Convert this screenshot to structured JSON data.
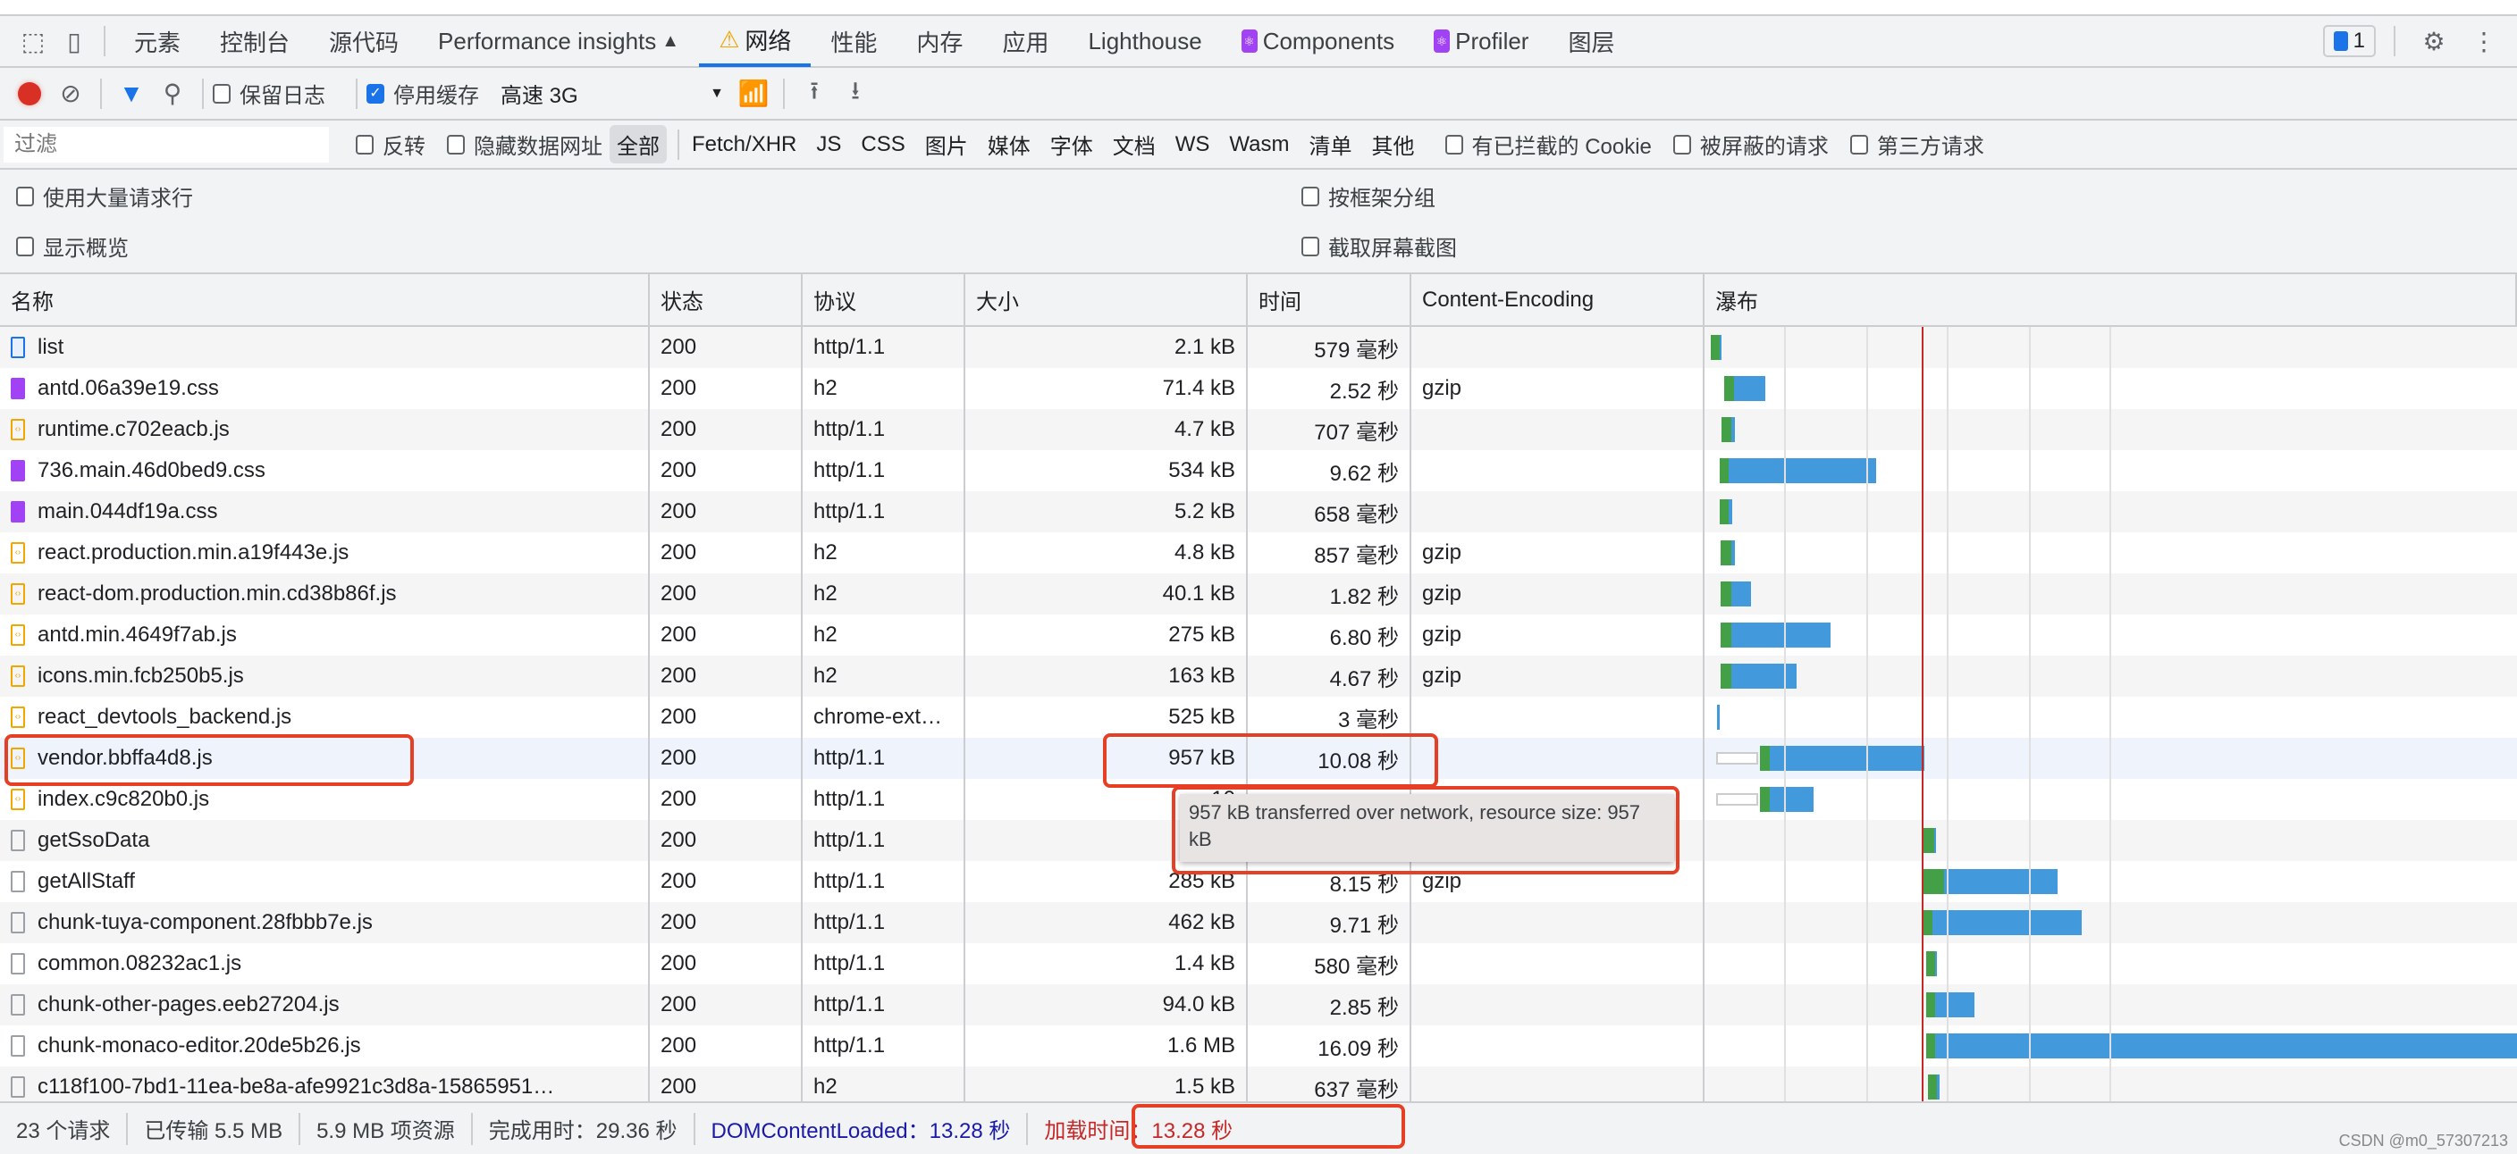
{
  "tabs": [
    {
      "label": "元素"
    },
    {
      "label": "控制台"
    },
    {
      "label": "源代码"
    },
    {
      "label": "Performance insights",
      "icon": "flask-icon"
    },
    {
      "label": "网络",
      "icon": "warning-icon",
      "active": true
    },
    {
      "label": "性能"
    },
    {
      "label": "内存"
    },
    {
      "label": "应用"
    },
    {
      "label": "Lighthouse"
    },
    {
      "label": "Components",
      "icon": "react-icon"
    },
    {
      "label": "Profiler",
      "icon": "react-icon"
    },
    {
      "label": "图层"
    }
  ],
  "issues_count": "1",
  "toolbar": {
    "preserve_log": "保留日志",
    "disable_cache": "停用缓存",
    "throttle": "高速 3G"
  },
  "filter": {
    "placeholder": "过滤",
    "invert": "反转",
    "hide_data_urls": "隐藏数据网址",
    "types": [
      "全部",
      "Fetch/XHR",
      "JS",
      "CSS",
      "图片",
      "媒体",
      "字体",
      "文档",
      "WS",
      "Wasm",
      "清单",
      "其他"
    ],
    "blocked_cookies": "有已拦截的 Cookie",
    "blocked_requests": "被屏蔽的请求",
    "third_party": "第三方请求"
  },
  "options": {
    "big_rows": "使用大量请求行",
    "overview": "显示概览",
    "group_by_frame": "按框架分组",
    "screenshots": "截取屏幕截图"
  },
  "columns": [
    "名称",
    "状态",
    "协议",
    "大小",
    "时间",
    "Content-Encoding",
    "瀑布"
  ],
  "rows": [
    {
      "name": "list",
      "type": "doc",
      "status": "200",
      "protocol": "http/1.1",
      "size": "2.1 kB",
      "time": "579 毫秒",
      "enc": ""
    },
    {
      "name": "antd.06a39e19.css",
      "type": "css",
      "status": "200",
      "protocol": "h2",
      "size": "71.4 kB",
      "time": "2.52 秒",
      "enc": "gzip"
    },
    {
      "name": "runtime.c702eacb.js",
      "type": "js",
      "status": "200",
      "protocol": "http/1.1",
      "size": "4.7 kB",
      "time": "707 毫秒",
      "enc": ""
    },
    {
      "name": "736.main.46d0bed9.css",
      "type": "css",
      "status": "200",
      "protocol": "http/1.1",
      "size": "534 kB",
      "time": "9.62 秒",
      "enc": ""
    },
    {
      "name": "main.044df19a.css",
      "type": "css",
      "status": "200",
      "protocol": "http/1.1",
      "size": "5.2 kB",
      "time": "658 毫秒",
      "enc": ""
    },
    {
      "name": "react.production.min.a19f443e.js",
      "type": "js",
      "status": "200",
      "protocol": "h2",
      "size": "4.8 kB",
      "time": "857 毫秒",
      "enc": "gzip"
    },
    {
      "name": "react-dom.production.min.cd38b86f.js",
      "type": "js",
      "status": "200",
      "protocol": "h2",
      "size": "40.1 kB",
      "time": "1.82 秒",
      "enc": "gzip"
    },
    {
      "name": "antd.min.4649f7ab.js",
      "type": "js",
      "status": "200",
      "protocol": "h2",
      "size": "275 kB",
      "time": "6.80 秒",
      "enc": "gzip"
    },
    {
      "name": "icons.min.fcb250b5.js",
      "type": "js",
      "status": "200",
      "protocol": "h2",
      "size": "163 kB",
      "time": "4.67 秒",
      "enc": "gzip"
    },
    {
      "name": "react_devtools_backend.js",
      "type": "js",
      "status": "200",
      "protocol": "chrome-ext…",
      "size": "525 kB",
      "time": "3 毫秒",
      "enc": ""
    },
    {
      "name": "vendor.bbffa4d8.js",
      "type": "js",
      "status": "200",
      "protocol": "http/1.1",
      "size": "957 kB",
      "time": "10.08 秒",
      "enc": "",
      "selected": true
    },
    {
      "name": "index.c9c820b0.js",
      "type": "js",
      "status": "200",
      "protocol": "http/1.1",
      "size": "10",
      "time": "",
      "enc": ""
    },
    {
      "name": "getSsoData",
      "type": "other",
      "status": "200",
      "protocol": "http/1.1",
      "size": "",
      "time": "",
      "enc": ""
    },
    {
      "name": "getAllStaff",
      "type": "other",
      "status": "200",
      "protocol": "http/1.1",
      "size": "285 kB",
      "time": "8.15 秒",
      "enc": "gzip"
    },
    {
      "name": "chunk-tuya-component.28fbbb7e.js",
      "type": "other",
      "status": "200",
      "protocol": "http/1.1",
      "size": "462 kB",
      "time": "9.71 秒",
      "enc": ""
    },
    {
      "name": "common.08232ac1.js",
      "type": "other",
      "status": "200",
      "protocol": "http/1.1",
      "size": "1.4 kB",
      "time": "580 毫秒",
      "enc": ""
    },
    {
      "name": "chunk-other-pages.eeb27204.js",
      "type": "other",
      "status": "200",
      "protocol": "http/1.1",
      "size": "94.0 kB",
      "time": "2.85 秒",
      "enc": ""
    },
    {
      "name": "chunk-monaco-editor.20de5b26.js",
      "type": "other",
      "status": "200",
      "protocol": "http/1.1",
      "size": "1.6 MB",
      "time": "16.09 秒",
      "enc": ""
    },
    {
      "name": "c118f100-7bd1-11ea-be8a-afe9921c3d8a-15865951…",
      "type": "other",
      "status": "200",
      "protocol": "h2",
      "size": "1.5 kB",
      "time": "637 毫秒",
      "enc": ""
    }
  ],
  "tooltip": "957 kB transferred over network, resource size: 957 kB",
  "status": {
    "requests": "23 个请求",
    "transferred": "已传输 5.5 MB",
    "resources": "5.9 MB 项资源",
    "finish": "完成用时：29.36 秒",
    "dcl": "DOMContentLoaded：13.28 秒",
    "load": "加载时间：13.28 秒"
  },
  "colors": {
    "accent": "#1a73e8",
    "waiting": "#43a047",
    "download": "#4299dc",
    "load_line": "#c62828",
    "highlight": "#e53f25",
    "dcl": "#1a1aa6"
  },
  "watermark": "CSDN @m0_57307213"
}
